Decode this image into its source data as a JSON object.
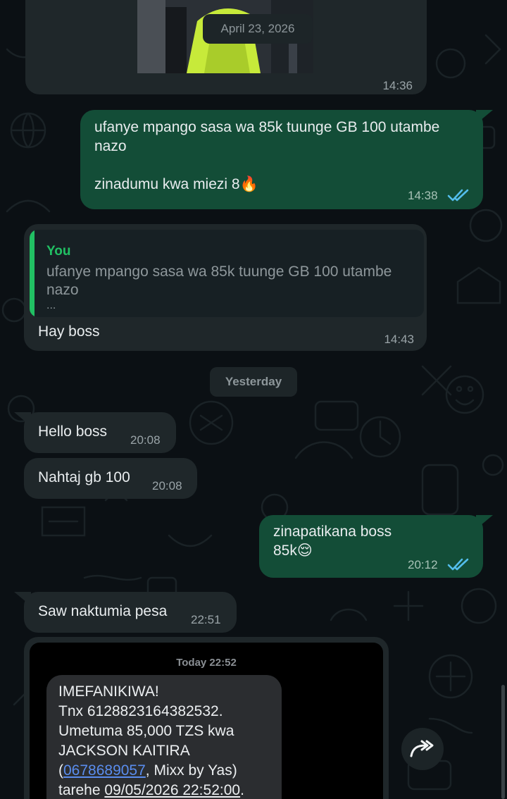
{
  "messages": {
    "photo_message": {
      "date_overlay": "April 23, 2026",
      "time": "14:36"
    },
    "out_1": {
      "text": "ufanye mpango sasa wa 85k tuunge GB 100 utambe\nnazo\n\nzinadumu kwa miezi 8🔥",
      "time": "14:38"
    },
    "reply_1": {
      "quote_author": "You",
      "quote_text": "ufanye mpango sasa wa 85k tuunge GB 100 utambe\nnazo",
      "quote_more": "...",
      "text": "Hay boss",
      "time": "14:43"
    },
    "date_divider": "Yesterday",
    "in_1": {
      "text": "Hello boss",
      "time": "20:08"
    },
    "in_2": {
      "text": "Nahtaj gb 100",
      "time": "20:08"
    },
    "out_2": {
      "text": "zinapatikana boss\n85k😌",
      "time": "20:12"
    },
    "in_3": {
      "text": "Saw naktumia pesa",
      "time": "22:51"
    },
    "screenshot_message": {
      "header": "Today 22:52",
      "sms_line_1": "IMEFANIKIWA!",
      "sms_line_2": "Tnx 6128823164382532.",
      "sms_line_3": "Umetuma 85,000 TZS kwa",
      "sms_line_4": "JACKSON KAITIRA",
      "sms_open_paren": "(",
      "sms_phone": "0678689057",
      "sms_after_phone": ", Mixx by Yas)",
      "sms_date_prefix": "tarehe ",
      "sms_date": "09/05/2026 22:52:00",
      "sms_date_suffix": "."
    }
  },
  "icons": {
    "read_receipt": "double-check-icon",
    "forward": "forward-icon",
    "read_color": "#53bdeb"
  },
  "colors": {
    "background": "#0b1014",
    "incoming_bubble": "#1f272a",
    "outgoing_bubble": "#134d37",
    "accent_green": "#21c063",
    "link_blue": "#5a8dee"
  }
}
